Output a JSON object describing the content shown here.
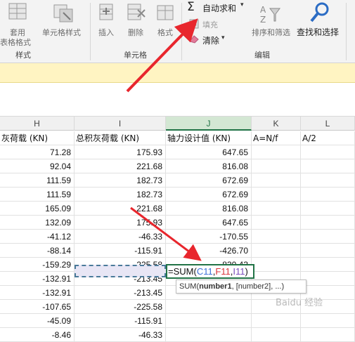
{
  "ribbon": {
    "styles_group": {
      "apply_table_format_line1": "套用",
      "apply_table_format_line2": "表格格式",
      "cell_styles": "单元格样式",
      "label": "样式"
    },
    "cells_group": {
      "insert": "插入",
      "delete": "删除",
      "format": "格式",
      "label": "单元格"
    },
    "editing_group": {
      "autosum": "自动求和",
      "fill": "填充",
      "clear": "清除",
      "sort_filter": "排序和筛选",
      "find_select": "查找和选择",
      "label": "编辑"
    }
  },
  "columns": {
    "H": "H",
    "I": "I",
    "J": "J",
    "K": "K",
    "L": "L"
  },
  "headers": {
    "H": "灰荷载 (KN)",
    "I": "总积灰荷载 (KN)",
    "J": "轴力设计值 (KN)",
    "K": "A=N/f",
    "L": "A/2"
  },
  "rows": [
    {
      "H": "71.28",
      "I": "175.93",
      "J": "647.65"
    },
    {
      "H": "92.04",
      "I": "221.68",
      "J": "816.08"
    },
    {
      "H": "111.59",
      "I": "182.73",
      "J": "672.69"
    },
    {
      "H": "111.59",
      "I": "182.73",
      "J": "672.69"
    },
    {
      "H": "165.09",
      "I": "221.68",
      "J": "816.08"
    },
    {
      "H": "132.09",
      "I": "175.93",
      "J": "647.65"
    },
    {
      "H": "-41.12",
      "I": "-46.33",
      "J": "-170.55"
    },
    {
      "H": "-88.14",
      "I": "-115.91",
      "J": "-426.70"
    },
    {
      "H": "-159.29",
      "I": "-225.58",
      "J": "-830.43"
    },
    {
      "H": "-132.91",
      "I": "-213.45",
      "J": ""
    },
    {
      "H": "-132.91",
      "I": "-213.45",
      "J": ""
    },
    {
      "H": "-107.65",
      "I": "-225.58",
      "J": ""
    },
    {
      "H": "-45.09",
      "I": "-115.91",
      "J": ""
    },
    {
      "H": "-8.46",
      "I": "-46.33",
      "J": ""
    }
  ],
  "formula": {
    "prefix": "=SUM(",
    "ref1": "C11",
    "sep1": ",",
    "ref2": "F11",
    "sep2": ",",
    "ref3": "I11",
    "suffix": ")"
  },
  "tooltip": {
    "fn": "SUM(",
    "arg1": "number1",
    "rest": ", [number2], ...)"
  },
  "watermark": "Baidu 经验",
  "colors": {
    "accent_green": "#217346",
    "arrow_red": "#e8262d",
    "ref1_color": "#3b6fd8",
    "ref2_color": "#d8343a",
    "ref3_color": "#7a4bbd"
  }
}
